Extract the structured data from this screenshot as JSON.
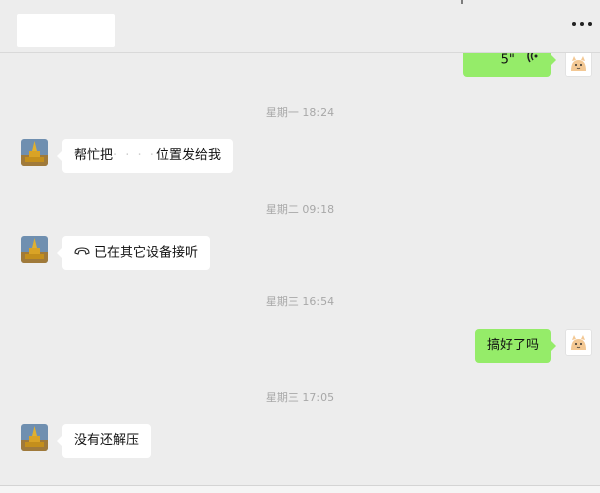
{
  "window": {
    "controls": [
      "pin-icon",
      "maximize-icon",
      "close-icon"
    ]
  },
  "header": {
    "more_icon": "more-dots-icon"
  },
  "messages": [
    {
      "type": "voice",
      "side": "me",
      "duration": "5\""
    },
    {
      "type": "time",
      "text": "星期一 18:24"
    },
    {
      "type": "text",
      "side": "friend",
      "text_before": "帮忙把",
      "redacted": "· ·  · ·",
      "text_after": "位置发给我"
    },
    {
      "type": "time",
      "text": "星期二 09:18"
    },
    {
      "type": "call",
      "side": "friend",
      "text": "已在其它设备接听",
      "icon": "phone-hangup-icon"
    },
    {
      "type": "time",
      "text": "星期三 16:54"
    },
    {
      "type": "text",
      "side": "me",
      "text": "搞好了吗"
    },
    {
      "type": "time",
      "text": "星期三 17:05"
    },
    {
      "type": "text",
      "side": "friend",
      "text": "没有还解压"
    }
  ],
  "colors": {
    "background": "#ededed",
    "bubble_in": "#ffffff",
    "bubble_out": "#95ec69",
    "timestamp": "#a8a8a8"
  }
}
